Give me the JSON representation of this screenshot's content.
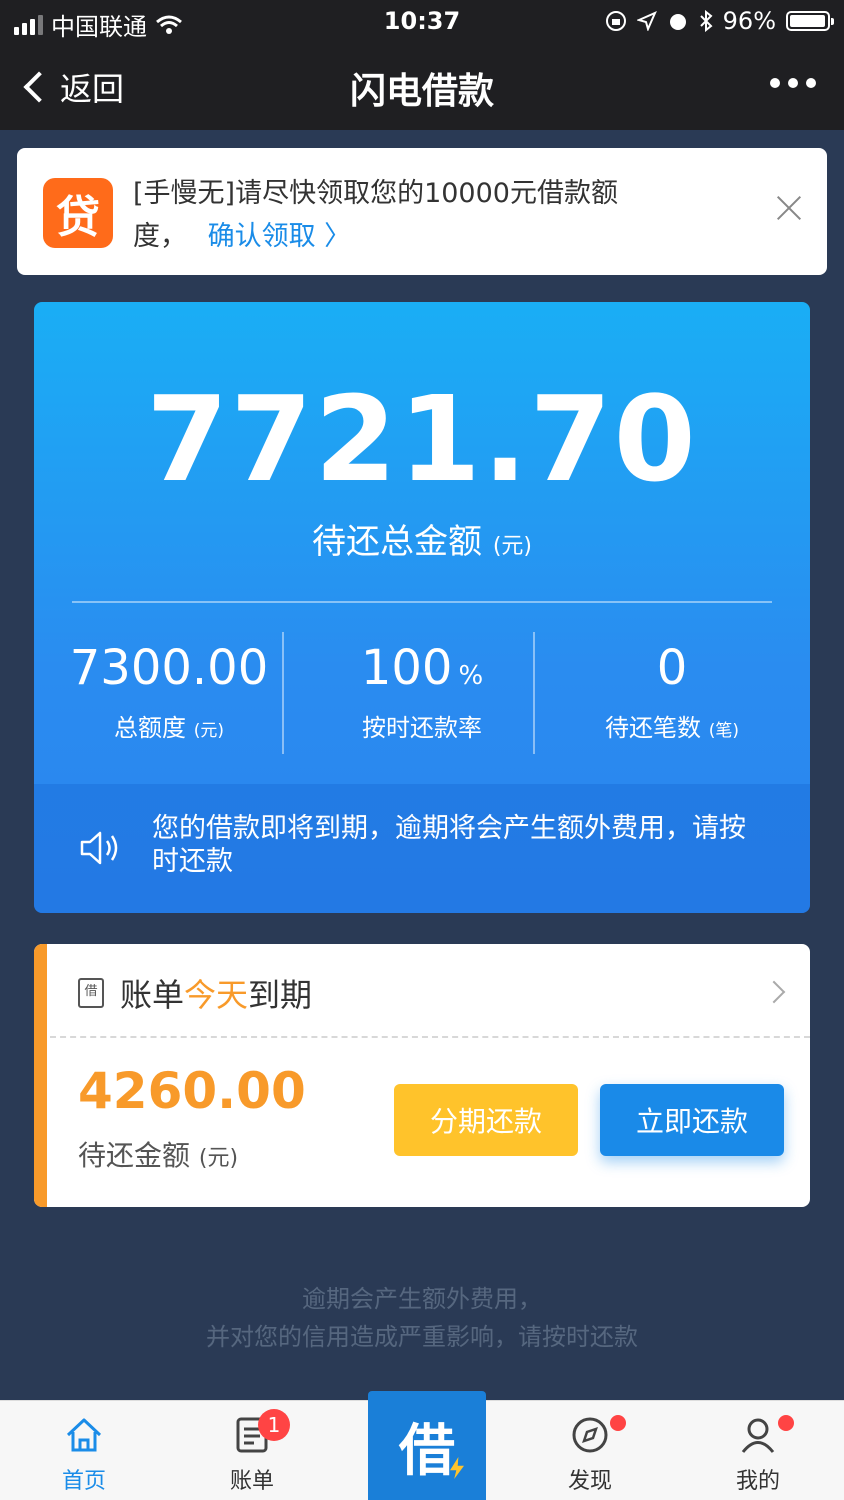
{
  "status_bar": {
    "carrier": "中国联通",
    "time": "10:37",
    "battery": "96%",
    "battery_level": 0.96
  },
  "nav": {
    "back_label": "返回",
    "title": "闪电借款"
  },
  "notice": {
    "logo_char": "贷",
    "text": "[手慢无]请尽快领取您的10000元借款额度，",
    "link": "确认领取 〉"
  },
  "summary": {
    "total_amount": "7721.70",
    "total_label": "待还总金额",
    "total_unit": "(元)",
    "stats": [
      {
        "value": "7300.00",
        "suffix": "",
        "label": "总额度",
        "unit": "(元)"
      },
      {
        "value": "100",
        "suffix": "%",
        "label": "按时还款率",
        "unit": ""
      },
      {
        "value": "0",
        "suffix": "",
        "label": "待还笔数",
        "unit": "(笔)"
      }
    ],
    "warning": "您的借款即将到期，逾期将会产生额外费用，请按时还款"
  },
  "bill": {
    "icon_char": "借",
    "title_prefix": "账单",
    "title_highlight": "今天",
    "title_suffix": "到期",
    "amount": "4260.00",
    "amount_label": "待还金额",
    "amount_unit": "(元)",
    "installment_button": "分期还款",
    "pay_button": "立即还款"
  },
  "footer_warning": {
    "line1": "逾期会产生额外费用，",
    "line2": "并对您的信用造成严重影响，请按时还款"
  },
  "tabs": {
    "home": "首页",
    "bills": "账单",
    "bills_badge": "1",
    "center": "借",
    "discover": "发现",
    "mine": "我的"
  },
  "colors": {
    "accent_blue": "#1a8ce8",
    "accent_orange": "#f89a2a",
    "installment_yellow": "#ffc32b"
  }
}
